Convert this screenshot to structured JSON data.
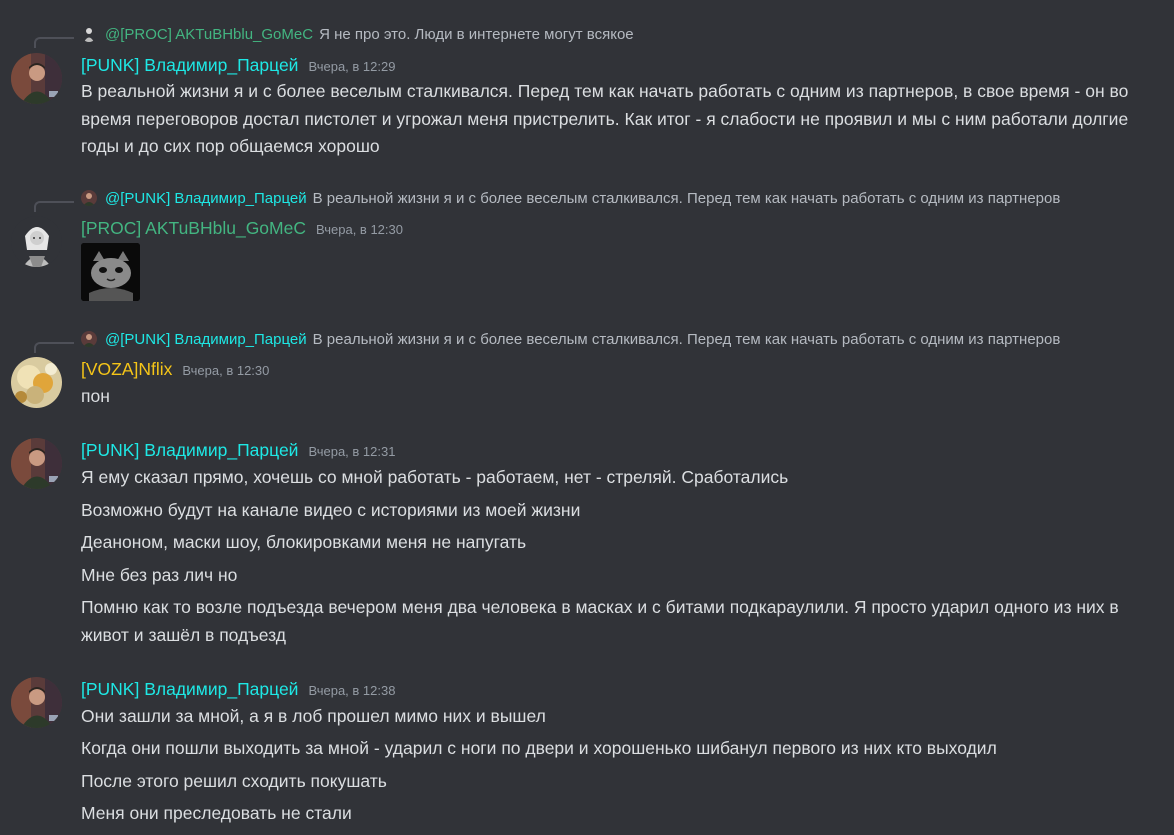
{
  "colors": {
    "background": "#313338",
    "punk_name": "#1ee8e5",
    "proc_name": "#43b581",
    "voza_name": "#f5c518",
    "text": "#dbdee1",
    "muted": "#949ba4"
  },
  "messages": [
    {
      "reply": {
        "name": "@[PROC] AKTuBHblu_GoMeC",
        "text": "Я не про это. Люди в интернете могут всякое",
        "avatar_icon": "proc-avatar-icon"
      },
      "author": "[PUNK] Владимир_Парцей",
      "timestamp": "Вчера, в 12:29",
      "lines": [
        "В реальной жизни я и с более веселым сталкивался. Перед тем как начать работать с одним из партнеров, в свое время - он во время переговоров достал пистолет и угрожал меня пристрелить. Как итог - я слабости не проявил и мы с ним работали долгие годы и до сих пор общаемся хорошо"
      ]
    },
    {
      "reply": {
        "name": "@[PUNK] Владимир_Парцей",
        "text": "В реальной жизни я и с более веселым сталкивался. Перед тем как начать работать с одним из партнеров",
        "avatar_icon": "punk-avatar-icon"
      },
      "author": "[PROC] AKTuBHblu_GoMeC",
      "timestamp": "Вчера, в 12:30",
      "attachment": "cat-meme-image"
    },
    {
      "reply": {
        "name": "@[PUNK] Владимир_Парцей",
        "text": "В реальной жизни я и с более веселым сталкивался. Перед тем как начать работать с одним из партнеров",
        "avatar_icon": "punk-avatar-icon"
      },
      "author": "[VOZA]Nflix",
      "timestamp": "Вчера, в 12:30",
      "lines": [
        "пон"
      ]
    },
    {
      "author": "[PUNK] Владимир_Парцей",
      "timestamp": "Вчера, в 12:31",
      "lines": [
        "Я ему сказал прямо, хочешь со мной работать - работаем, нет - стреляй. Сработались",
        "Возможно будут на канале видео с историями из моей жизни",
        "Деаноном, маски шоу, блокировками меня не напугать",
        "Мне без раз лич но",
        "Помню как то возле подъезда вечером меня два человека в масках и с битами подкараулили. Я просто ударил одного из них в живот и зашёл в подъезд"
      ]
    },
    {
      "author": "[PUNK] Владимир_Парцей",
      "timestamp": "Вчера, в 12:38",
      "lines": [
        "Они зашли за мной, а я в лоб прошел мимо них и вышел",
        "Когда они пошли выходить за мной - ударил с ноги по двери и хорошенько шибанул первого из них кто выходил",
        "После этого решил сходить покушать",
        "Меня они преследовать не стали"
      ]
    }
  ]
}
